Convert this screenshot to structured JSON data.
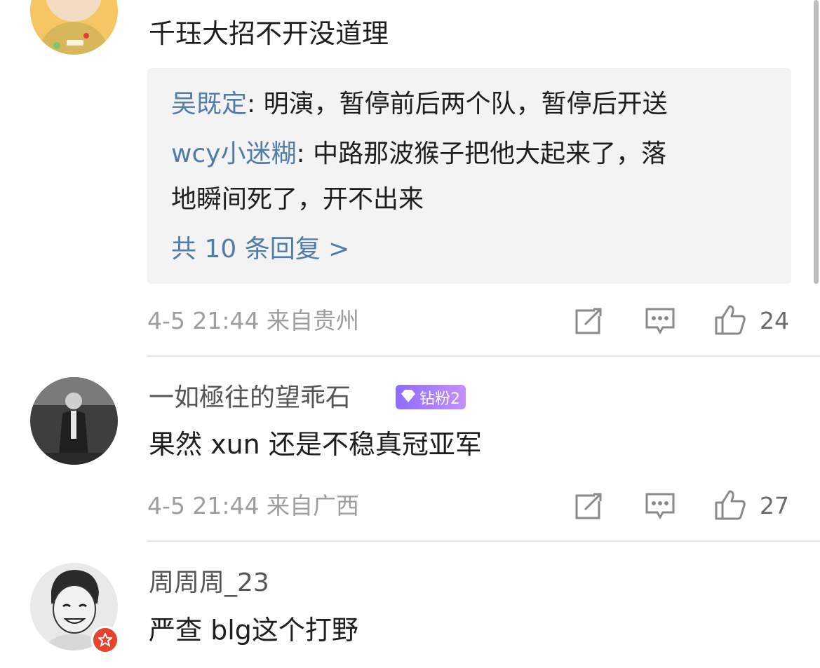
{
  "comments": [
    {
      "text": "千珏大招不开没道理",
      "replies": [
        {
          "user": "吴既定",
          "text": ": 明演，暂停前后两个队，暂停后开送"
        },
        {
          "user": "wcy小迷糊",
          "text": ": 中路那波猴子把他大起来了，落",
          "text_cont": "地瞬间死了，开不出来"
        }
      ],
      "more_replies": "共 10 条回复 >",
      "meta": "4-5 21:44  来自贵州",
      "likes": "24"
    },
    {
      "username": "一如極往的望乖石",
      "badge": "钻粉2",
      "text": "果然 xun 还是不稳真冠亚军",
      "meta": "4-5 21:44  来自广西",
      "likes": "27"
    },
    {
      "username": "周周周_23",
      "text": "严查 blg这个打野"
    }
  ],
  "colors": {
    "link_blue": "#4f7ca8",
    "reply_bg": "#f3f3f3",
    "meta_gray": "#9e9e9e",
    "badge_purple": "#a77cff",
    "vip_red": "#e8432c"
  },
  "icons": {
    "share": "share-icon",
    "comment": "comment-icon",
    "like": "thumbs-up-icon"
  }
}
